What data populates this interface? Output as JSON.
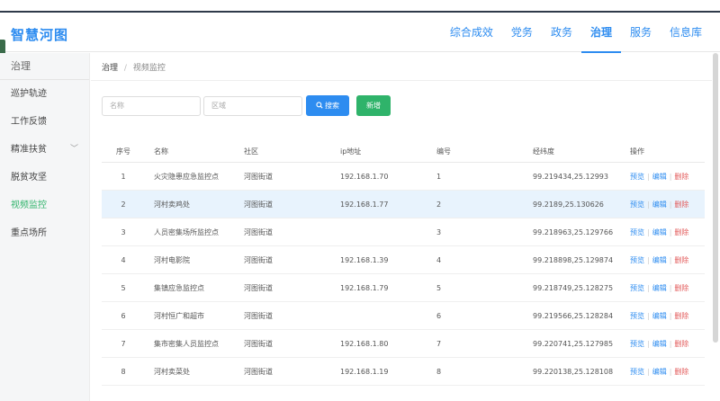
{
  "app": {
    "logo": "智慧河图"
  },
  "nav": [
    {
      "label": "综合成效",
      "active": false
    },
    {
      "label": "党务",
      "active": false
    },
    {
      "label": "政务",
      "active": false
    },
    {
      "label": "治理",
      "active": true
    },
    {
      "label": "服务",
      "active": false
    },
    {
      "label": "信息库",
      "active": false
    }
  ],
  "sidebar": {
    "header": "治理",
    "items": [
      {
        "label": "巡护轨迹",
        "active": false
      },
      {
        "label": "工作反馈",
        "active": false
      },
      {
        "label": "精准扶贫",
        "active": false,
        "has_chevron": true
      },
      {
        "label": "脱贫攻坚",
        "active": false
      },
      {
        "label": "视频监控",
        "active": true
      },
      {
        "label": "重点场所",
        "active": false
      }
    ]
  },
  "breadcrumb": {
    "level1": "治理",
    "separator": "/",
    "level2": "视频监控"
  },
  "filters": {
    "name_placeholder": "名称",
    "area_placeholder": "区域",
    "search_label": "搜索",
    "add_label": "新增"
  },
  "table": {
    "headers": [
      "序号",
      "名称",
      "社区",
      "ip地址",
      "编号",
      "经纬度",
      "操作"
    ],
    "actions": {
      "preview": "预览",
      "edit": "编辑",
      "delete": "删除",
      "separator": "|"
    },
    "rows": [
      {
        "idx": "1",
        "name": "火灾隐患应急监控点",
        "community": "河图街道",
        "ip": "192.168.1.70",
        "num": "1",
        "geo": "99.219434,25.12993"
      },
      {
        "idx": "2",
        "name": "河村卖鸡处",
        "community": "河图街道",
        "ip": "192.168.1.77",
        "num": "2",
        "geo": "99.2189,25.130626"
      },
      {
        "idx": "3",
        "name": "人员密集场所监控点",
        "community": "河图街道",
        "ip": "",
        "num": "3",
        "geo": "99.218963,25.129766"
      },
      {
        "idx": "4",
        "name": "河村电影院",
        "community": "河图街道",
        "ip": "192.168.1.39",
        "num": "4",
        "geo": "99.218898,25.129874"
      },
      {
        "idx": "5",
        "name": "集镇应急监控点",
        "community": "河图街道",
        "ip": "192.168.1.79",
        "num": "5",
        "geo": "99.218749,25.128275"
      },
      {
        "idx": "6",
        "name": "河村恒广和超市",
        "community": "河图街道",
        "ip": "",
        "num": "6",
        "geo": "99.219566,25.128284"
      },
      {
        "idx": "7",
        "name": "集市密集人员监控点",
        "community": "河图街道",
        "ip": "192.168.1.80",
        "num": "7",
        "geo": "99.220741,25.127985"
      },
      {
        "idx": "8",
        "name": "河村卖菜处",
        "community": "河图街道",
        "ip": "192.168.1.19",
        "num": "8",
        "geo": "99.220138,25.128108"
      }
    ]
  },
  "colors": {
    "accent": "#2d8cf0",
    "success": "#2fb36a",
    "danger": "#e35b5b",
    "highlight_row": "#e8f3fd"
  },
  "icons": {
    "search": "search-icon",
    "chevron": "chevron-down-icon"
  }
}
